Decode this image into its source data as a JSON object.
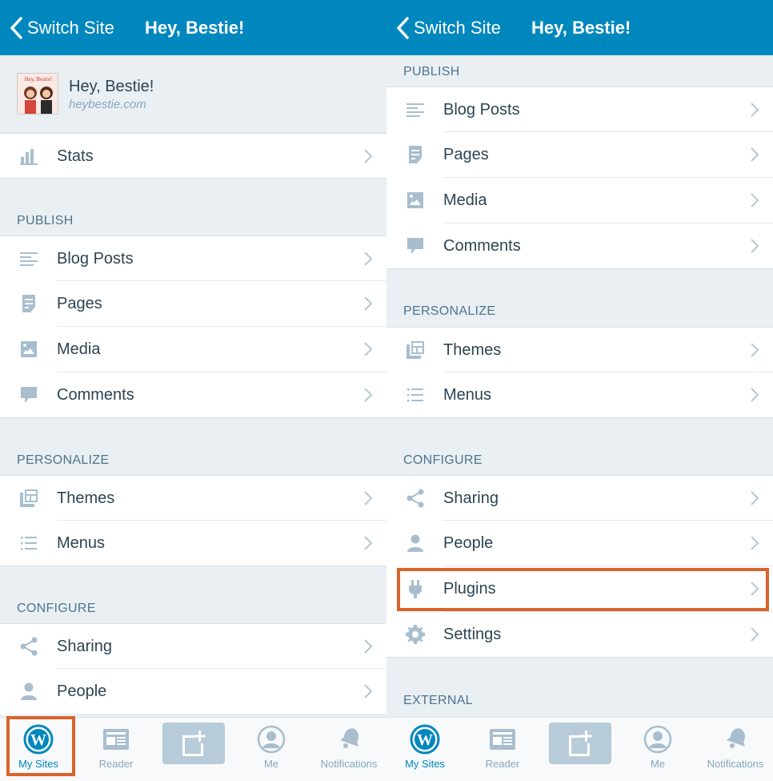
{
  "colors": {
    "navbar": "#0087be",
    "accent": "#0087be",
    "highlight": "#d9632c",
    "icon": "#a8bece",
    "text": "#2e4453",
    "section": "#4f748e",
    "background": "#e9eff3"
  },
  "navbar": {
    "back_label": "Switch Site",
    "title": "Hey, Bestie!"
  },
  "site": {
    "name": "Hey, Bestie!",
    "url": "heybestie.com",
    "avatar_text": "Hey, Bestie!"
  },
  "left": {
    "stats_label": "Stats",
    "publish_header": "PUBLISH",
    "publish_items": [
      "Blog Posts",
      "Pages",
      "Media",
      "Comments"
    ],
    "personalize_header": "PERSONALIZE",
    "personalize_items": [
      "Themes",
      "Menus"
    ],
    "configure_header": "CONFIGURE",
    "configure_items": [
      "Sharing",
      "People"
    ]
  },
  "right": {
    "publish_header": "PUBLISH",
    "publish_items": [
      "Blog Posts",
      "Pages",
      "Media",
      "Comments"
    ],
    "personalize_header": "PERSONALIZE",
    "personalize_items": [
      "Themes",
      "Menus"
    ],
    "configure_header": "CONFIGURE",
    "configure_items": [
      "Sharing",
      "People",
      "Plugins",
      "Settings"
    ],
    "external_header": "EXTERNAL"
  },
  "tabbar": {
    "my_sites": "My Sites",
    "reader": "Reader",
    "me": "Me",
    "notifications": "Notifications"
  }
}
